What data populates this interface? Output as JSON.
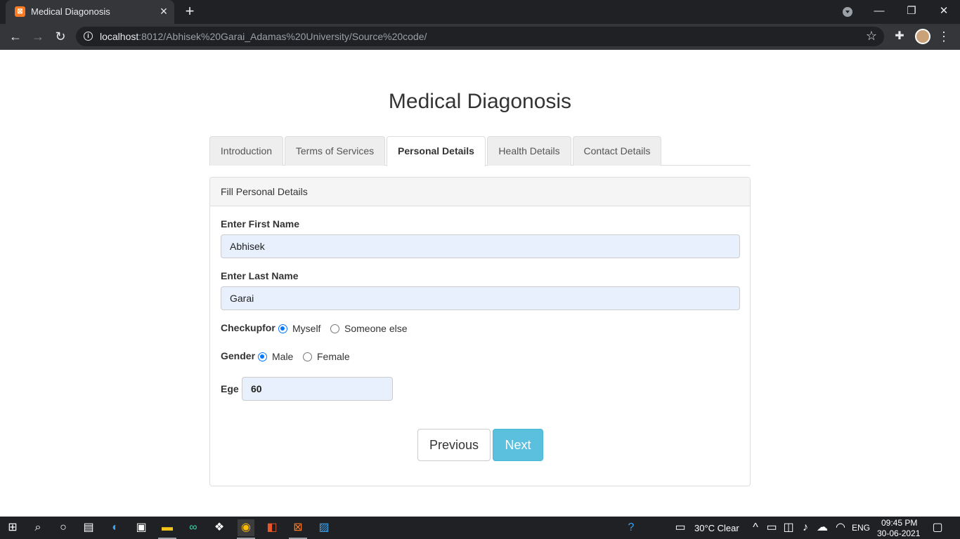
{
  "browser": {
    "tab_title": "Medical Diagonosis",
    "tab_favicon": "xampp-icon",
    "url_host": "localhost",
    "url_rest": ":8012/Abhisek%20Garai_Adamas%20University/Source%20code/"
  },
  "page": {
    "title": "Medical Diagonosis",
    "tabs": [
      {
        "label": "Introduction",
        "active": false
      },
      {
        "label": "Terms of Services",
        "active": false
      },
      {
        "label": "Personal Details",
        "active": true
      },
      {
        "label": "Health Details",
        "active": false
      },
      {
        "label": "Contact Details",
        "active": false
      }
    ],
    "panel_heading": "Fill Personal Details",
    "form": {
      "first_name_label": "Enter First Name",
      "first_name_value": "Abhisek",
      "last_name_label": "Enter Last Name",
      "last_name_value": "Garai",
      "checkupfor_label": "Checkupfor",
      "checkupfor_options": [
        {
          "label": "Myself",
          "checked": true
        },
        {
          "label": "Someone else",
          "checked": false
        }
      ],
      "gender_label": "Gender",
      "gender_options": [
        {
          "label": "Male",
          "checked": true
        },
        {
          "label": "Female",
          "checked": false
        }
      ],
      "age_label": "Ege",
      "age_value": "60"
    },
    "buttons": {
      "previous": "Previous",
      "next": "Next"
    }
  },
  "taskbar": {
    "weather": "30°C  Clear",
    "language": "ENG",
    "time": "09:45 PM",
    "date": "30-06-2021"
  },
  "colors": {
    "accent_next": "#5bc0de",
    "input_autofill": "#e8f0fe",
    "radio_checked": "#0075ff"
  }
}
